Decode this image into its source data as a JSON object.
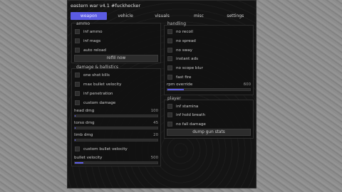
{
  "title": "eastern war v4.1 #fuckhecker",
  "tabs": [
    "weapon",
    "vehicle",
    "visuals",
    "misc",
    "settings"
  ],
  "left": {
    "ammo": {
      "header": "ammo",
      "checks": [
        "inf ammo",
        "inf mags",
        "auto reload"
      ],
      "button": "refill now"
    },
    "damage": {
      "header": "damage & ballistics",
      "checks": [
        "one shot kills",
        "max bullet velocity",
        "inf penetration",
        "custom damage"
      ],
      "sliders": [
        {
          "label": "head dmg",
          "value": "100",
          "fraction": 0.0
        },
        {
          "label": "torso dmg",
          "value": "45",
          "fraction": 0.0
        },
        {
          "label": "limb dmg",
          "value": "20",
          "fraction": 0.0
        }
      ],
      "check2": "custom bullet velocity",
      "slider2": {
        "label": "bullet velocity",
        "value": "500",
        "fraction": 0.1
      }
    }
  },
  "right": {
    "handling": {
      "header": "handling",
      "checks": [
        "no recoil",
        "no spread",
        "no sway",
        "instant ads",
        "no scope blur",
        "fast fire"
      ],
      "slider": {
        "label": "rpm override",
        "value": "600",
        "fraction": 0.2
      }
    },
    "player": {
      "header": "player",
      "checks": [
        "inf stamina",
        "inf hold breath",
        "no fall damage"
      ],
      "button": "dump gun stats"
    }
  },
  "colors": {
    "accent": "#5b5be2",
    "window": "#141414"
  }
}
